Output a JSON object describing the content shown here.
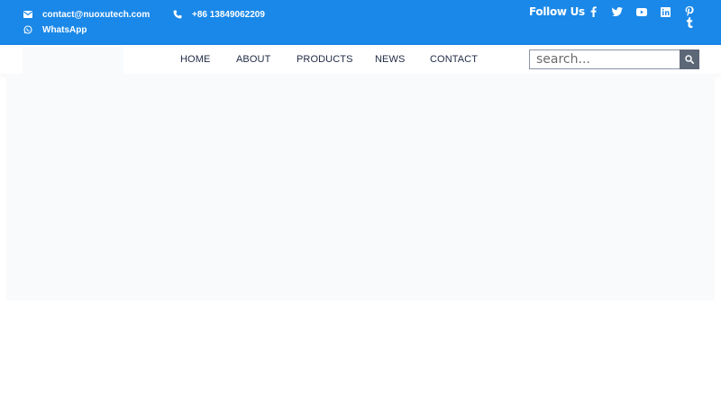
{
  "topbar": {
    "email": "contact@nuoxutech.com",
    "phone": "+86 13849062209",
    "whatsapp": "WhatsApp",
    "follow_label": "Follow Us",
    "social_icons": [
      "facebook-icon",
      "twitter-icon",
      "youtube-icon",
      "linkedin-icon",
      "pinterest-icon",
      "tumblr-icon"
    ]
  },
  "nav": {
    "items": [
      {
        "label": "HOME"
      },
      {
        "label": "ABOUT"
      },
      {
        "label": "PRODUCTS"
      },
      {
        "label": "NEWS"
      },
      {
        "label": "CONTACT"
      }
    ]
  },
  "search": {
    "placeholder": "search..."
  },
  "colors": {
    "topbar_bg": "#1a88e8",
    "search_button_bg": "#5c6777",
    "banner_bg": "#f9fafc"
  }
}
